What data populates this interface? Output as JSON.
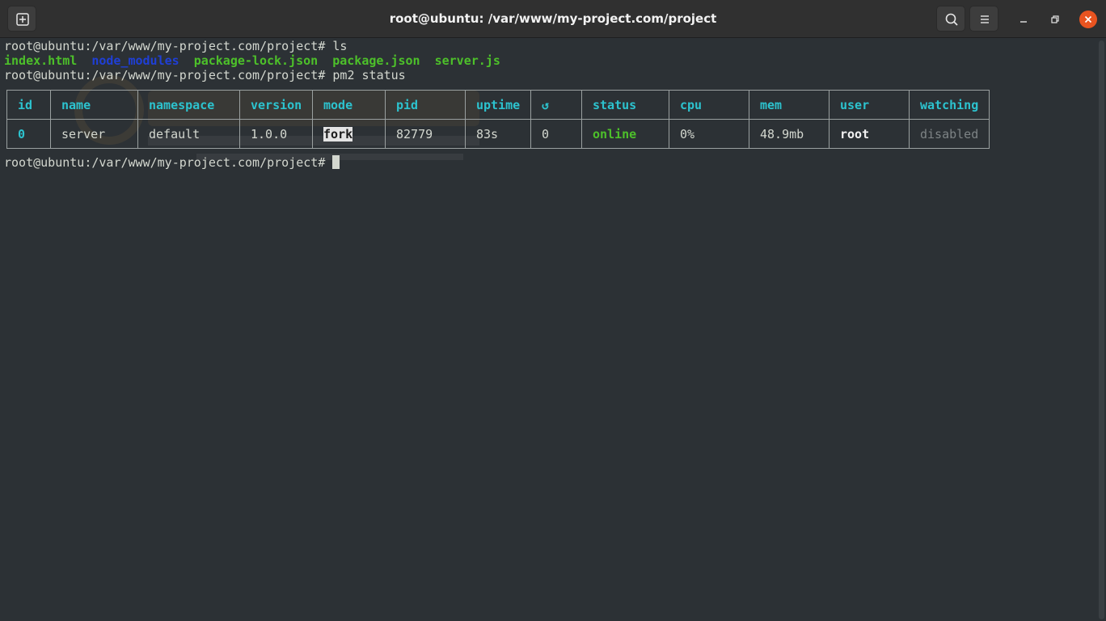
{
  "window": {
    "title": "root@ubuntu: /var/www/my-project.com/project",
    "accent_color": "#e95420"
  },
  "toolbar": {
    "new_tab_icon": "new-tab-icon",
    "search_icon": "search-icon",
    "menu_icon": "hamburger-menu-icon",
    "minimize_icon": "minimize-icon",
    "maximize_icon": "maximize-icon",
    "close_icon": "close-icon"
  },
  "terminal": {
    "prompt": "root@ubuntu:/var/www/my-project.com/project# ",
    "commands": [
      "ls",
      "pm2 status"
    ],
    "ls_output": [
      {
        "name": "index.html",
        "kind": "file"
      },
      {
        "name": "node_modules",
        "kind": "dir"
      },
      {
        "name": "package-lock.json",
        "kind": "file"
      },
      {
        "name": "package.json",
        "kind": "file"
      },
      {
        "name": "server.js",
        "kind": "file"
      }
    ],
    "pm2_table": {
      "headers": [
        "id",
        "name",
        "namespace",
        "version",
        "mode",
        "pid",
        "uptime",
        "↺",
        "status",
        "cpu",
        "mem",
        "user",
        "watching"
      ],
      "rows": [
        [
          "0",
          "server",
          "default",
          "1.0.0",
          "fork",
          "82779",
          "83s",
          "0",
          "online",
          "0%",
          "48.9mb",
          "root",
          "disabled"
        ]
      ]
    }
  },
  "colors": {
    "background": "#2c3135",
    "header_cyan": "#2cc3cf",
    "file_green": "#4dc02a",
    "dir_blue": "#1f3fd6",
    "text": "#d3d7cf"
  }
}
